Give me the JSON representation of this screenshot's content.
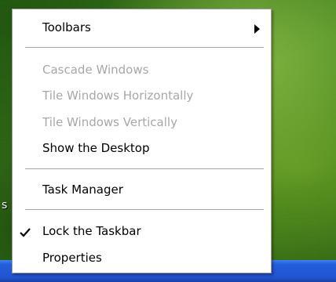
{
  "desktop": {
    "fragment_text": "s"
  },
  "context_menu": {
    "items": [
      {
        "label": "Toolbars",
        "enabled": true,
        "has_submenu": true,
        "submenu_icon": "chevron-right-icon"
      },
      {
        "label": "Cascade Windows",
        "enabled": false
      },
      {
        "label": "Tile Windows Horizontally",
        "enabled": false
      },
      {
        "label": "Tile Windows Vertically",
        "enabled": false
      },
      {
        "label": "Show the Desktop",
        "enabled": true
      },
      {
        "label": "Task Manager",
        "enabled": true
      },
      {
        "label": "Lock the Taskbar",
        "enabled": true,
        "checked": true,
        "check_icon": "checkmark-icon"
      },
      {
        "label": "Properties",
        "enabled": true
      }
    ]
  },
  "colors": {
    "menu_background": "#ffffff",
    "disabled_text": "#a7a7a7",
    "separator": "#a6a6a6",
    "taskbar_blue": "#245edb"
  }
}
